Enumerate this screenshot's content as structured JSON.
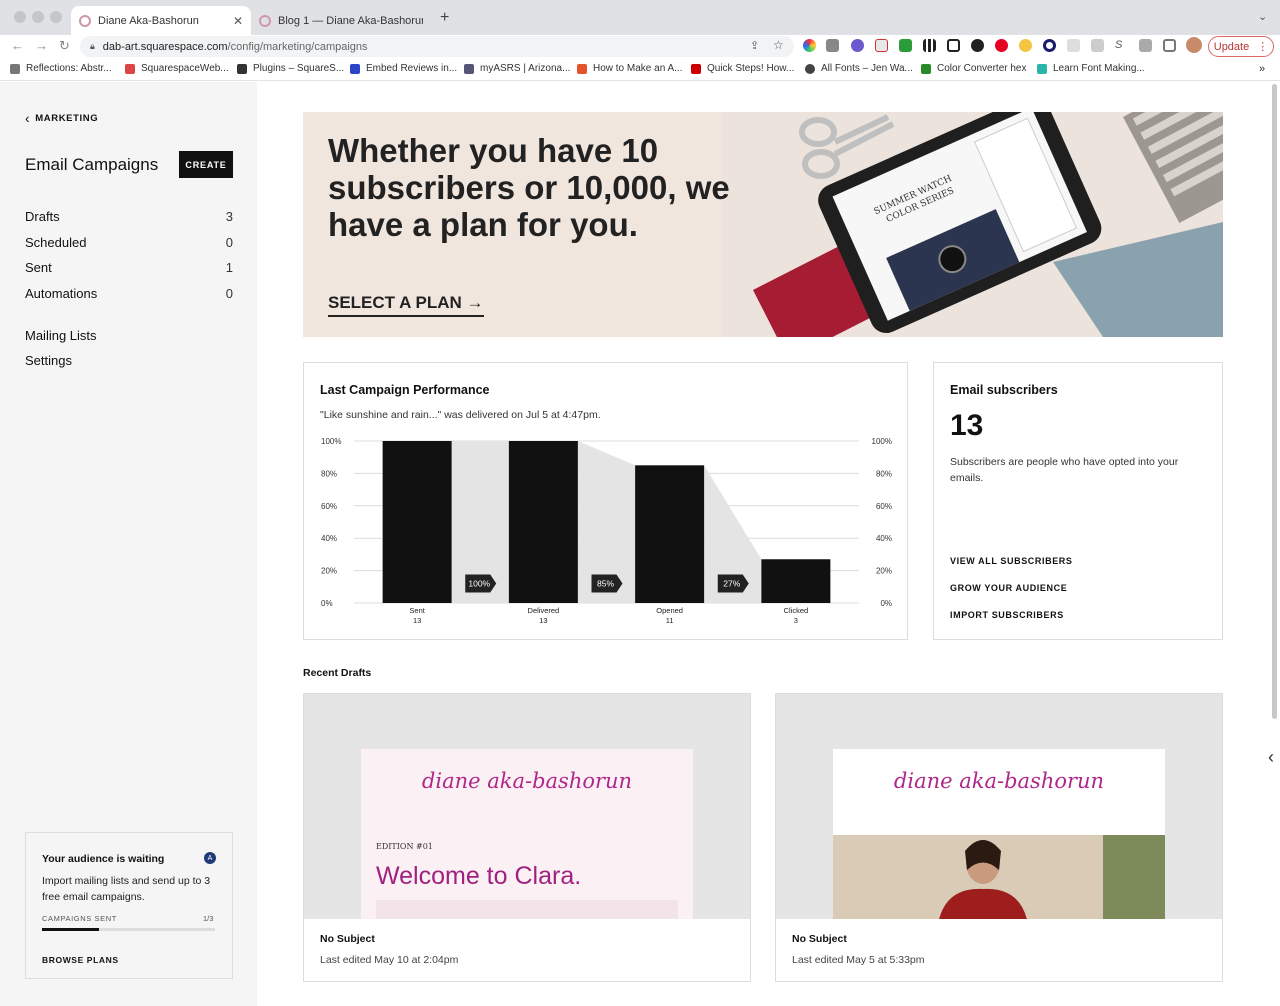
{
  "browser": {
    "tabs": [
      {
        "title": "Diane Aka-Bashorun",
        "active": true
      },
      {
        "title": "Blog 1 — Diane Aka-Bashorun",
        "active": false
      }
    ],
    "new_tab": "+",
    "url_host": "dab-art.squarespace.com",
    "url_path": "/config/marketing/campaigns",
    "update_label": "Update",
    "bookmarks": [
      "Reflections: Abstr...",
      "SquarespaceWeb...",
      "Plugins – SquareS...",
      "Embed Reviews in...",
      "myASRS | Arizona...",
      "How to Make an A...",
      "Quick Steps! How...",
      "All Fonts – Jen Wa...",
      "Color Converter hex",
      "Learn Font Making..."
    ],
    "more_bookmarks": "»"
  },
  "sidebar": {
    "back_label": "MARKETING",
    "title": "Email Campaigns",
    "create_label": "CREATE",
    "nav": [
      {
        "label": "Drafts",
        "count": "3"
      },
      {
        "label": "Scheduled",
        "count": "0"
      },
      {
        "label": "Sent",
        "count": "1"
      },
      {
        "label": "Automations",
        "count": "0"
      }
    ],
    "nav2": [
      {
        "label": "Mailing Lists"
      },
      {
        "label": "Settings"
      }
    ],
    "audience": {
      "title": "Your audience is waiting",
      "badge": "A",
      "text": "Import mailing lists and send up to 3 free email campaigns.",
      "progress_label": "CAMPAIGNS SENT",
      "progress_count": "1/3",
      "progress_fraction": 0.33,
      "cta": "BROWSE PLANS"
    }
  },
  "hero": {
    "headline": "Whether you have 10 subscribers or 10,000, we have a plan for you.",
    "cta": "SELECT A PLAN →",
    "device_text": [
      "SUMMER WATCH",
      "COLOR SERIES"
    ]
  },
  "performance": {
    "title": "Last Campaign Performance",
    "subtitle": "\"Like sunshine and rain...\" was delivered on Jul 5 at 4:47pm."
  },
  "chart_data": {
    "type": "bar",
    "categories": [
      "Sent",
      "Delivered",
      "Opened",
      "Clicked"
    ],
    "values": [
      13,
      13,
      11,
      3
    ],
    "value_labels": [
      "13",
      "13",
      "11",
      "3"
    ],
    "percent_heights": [
      100,
      100,
      85,
      27
    ],
    "conversions": [
      "100%",
      "85%",
      "27%"
    ],
    "y_ticks": [
      "100%",
      "80%",
      "60%",
      "40%",
      "20%",
      "0%"
    ],
    "ylim": [
      0,
      100
    ],
    "grid": true
  },
  "subscribers": {
    "title": "Email subscribers",
    "count": "13",
    "description": "Subscribers are people who have opted into your emails.",
    "links": [
      "VIEW ALL SUBSCRIBERS",
      "GROW YOUR AUDIENCE",
      "IMPORT SUBSCRIBERS"
    ]
  },
  "recent": {
    "title": "Recent Drafts",
    "drafts": [
      {
        "title": "No Subject",
        "meta": "Last edited May 10 at 2:04pm",
        "logo": "diane aka-bashorun",
        "edition": "EDITION #01",
        "headline": "Welcome to Clara."
      },
      {
        "title": "No Subject",
        "meta": "Last edited May 5 at 5:33pm",
        "logo": "diane aka-bashorun"
      }
    ]
  },
  "colors": {
    "accent": "#111111",
    "brand_pink": "#b0278a",
    "hero_bg": "#f1e6de",
    "sidebar_bg": "#f5f5f5"
  }
}
